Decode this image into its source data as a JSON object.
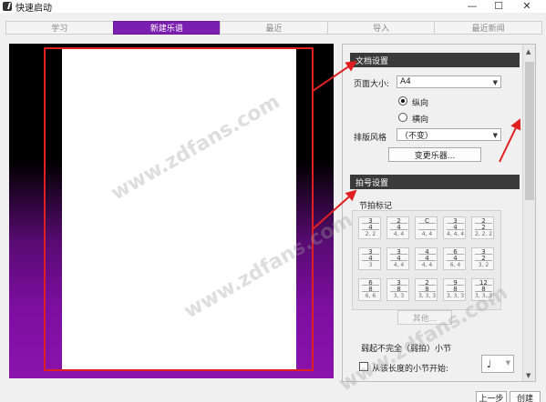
{
  "window": {
    "title": "快速启动",
    "min_icon": "minimize-icon",
    "max_icon": "maximize-icon",
    "close_icon": "close-icon"
  },
  "tabs": [
    {
      "label": "学习",
      "active": false
    },
    {
      "label": "新建乐谱",
      "active": true
    },
    {
      "label": "最近",
      "active": false
    },
    {
      "label": "导入",
      "active": false
    },
    {
      "label": "最近新闻",
      "active": false
    }
  ],
  "doc_settings": {
    "header": "文档设置",
    "page_size_label": "页面大小:",
    "page_size_value": "A4",
    "orientation_portrait": "纵向",
    "orientation_landscape": "横向",
    "orientation_selected": "纵向",
    "layout_style_label": "排版风格",
    "layout_style_value": "（不变）",
    "change_instruments_button": "变更乐器..."
  },
  "time_sig_settings": {
    "header": "拍号设置",
    "group_label": "节拍标记",
    "signatures": [
      {
        "sym": "3\n4",
        "sub": "2, 2"
      },
      {
        "sym": "2\n4",
        "sub": "4, 4"
      },
      {
        "sym": "C",
        "sub": "4, 4"
      },
      {
        "sym": "3\n4",
        "sub": "4, 4, 4"
      },
      {
        "sym": "2\n2",
        "sub": "2, 2, 2"
      },
      {
        "sym": "3\n4",
        "sub": "3"
      },
      {
        "sym": "3\n4",
        "sub": "4, 4"
      },
      {
        "sym": "4\n4",
        "sub": "4, 4"
      },
      {
        "sym": "6\n4",
        "sub": "6, 4"
      },
      {
        "sym": "3\n2",
        "sub": "3, 2"
      },
      {
        "sym": "6\n8",
        "sub": "6, 6"
      },
      {
        "sym": "3\n8",
        "sub": "3, 3"
      },
      {
        "sym": "2\n8",
        "sub": "3, 3, 3"
      },
      {
        "sym": "9\n8",
        "sub": "3, 3, 3"
      },
      {
        "sym": "12\n8",
        "sub": "3, 3, 3"
      }
    ],
    "other_button": "其他...",
    "pickup_label": "弱起不完全（弱拍）小节",
    "pickup_checkbox_label": "从该长度的小节开始:",
    "pickup_note": "♩"
  },
  "footer": {
    "prev_button": "上一步",
    "create_button": "创建"
  },
  "watermark": "www.zdfans.com",
  "colors": {
    "accent": "#7a1fb0",
    "section_header": "#3a3a3a",
    "highlight_red": "#e02020"
  }
}
